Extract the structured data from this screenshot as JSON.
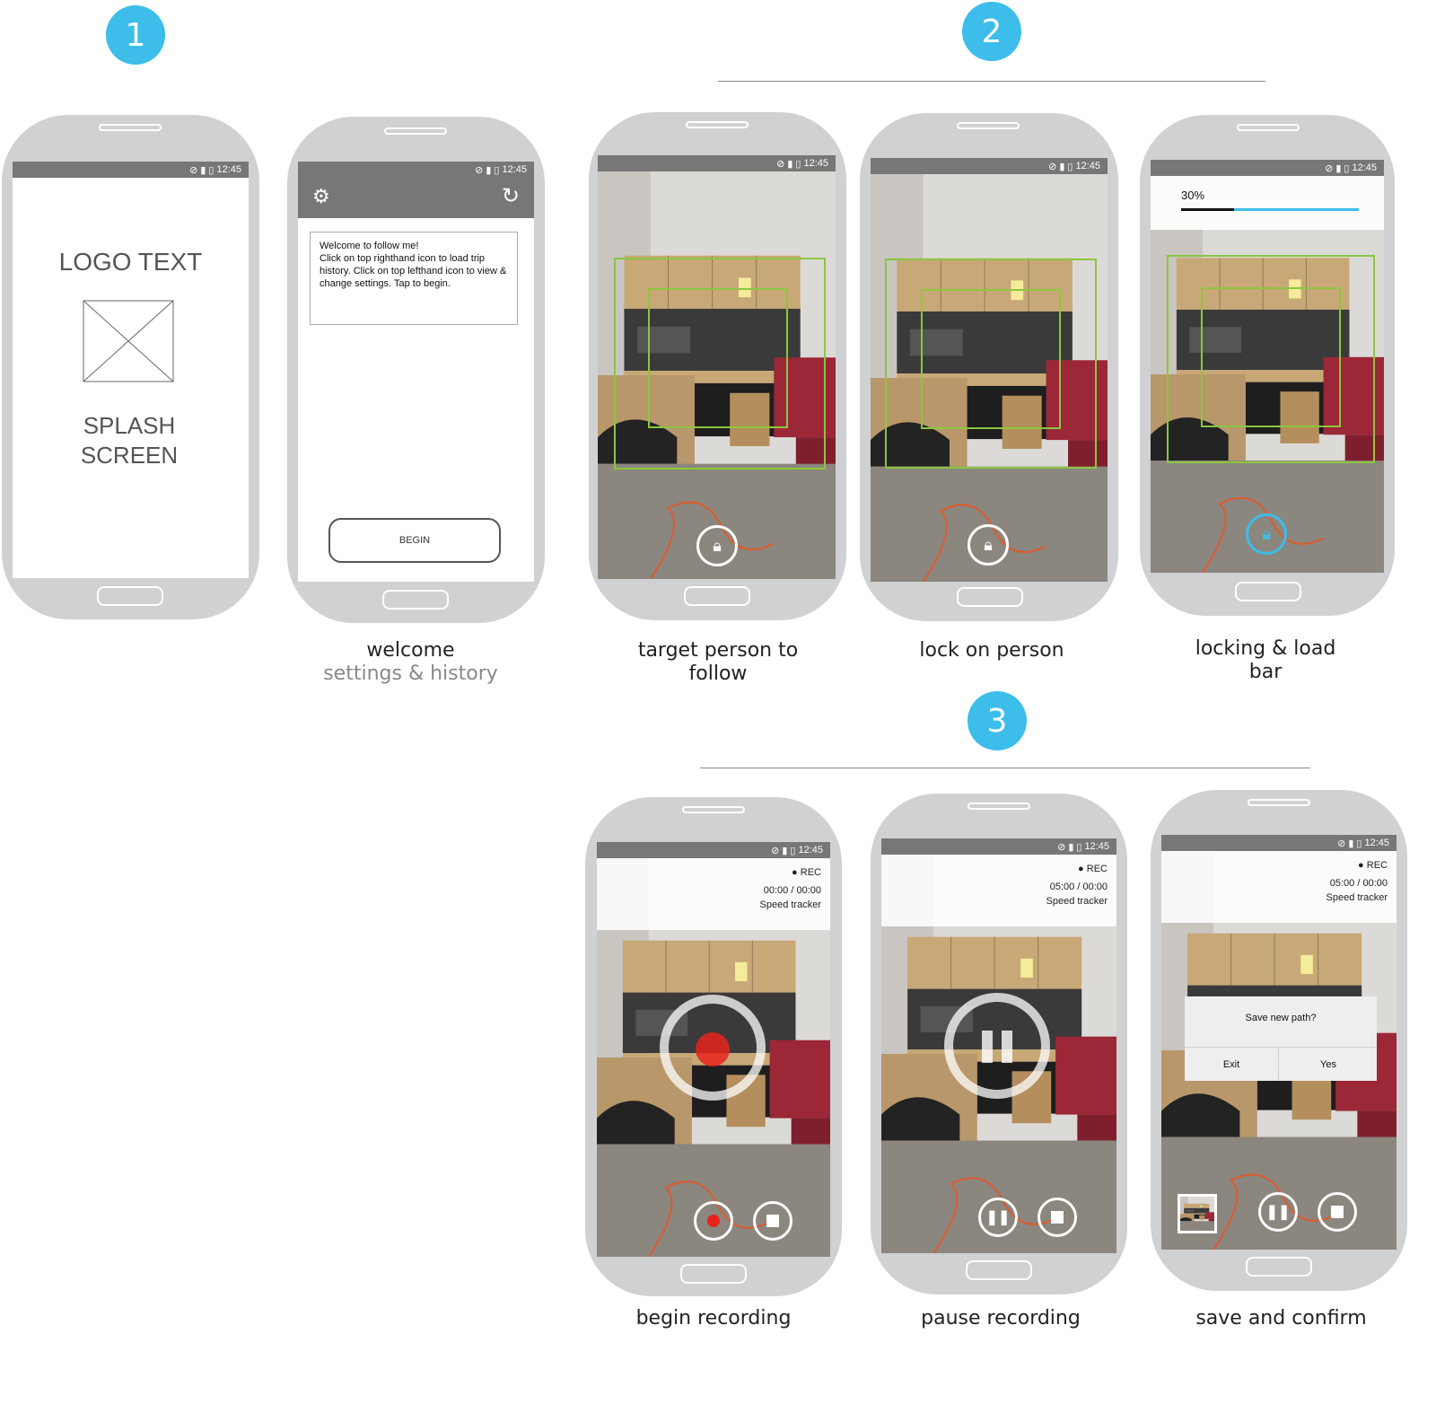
{
  "steps": [
    "1",
    "2",
    "3"
  ],
  "status_time": "12:45",
  "splash": {
    "logo_text": "LOGO TEXT",
    "splash_text": "SPLASH SCREEN"
  },
  "welcome": {
    "message": "Welcome to follow me!\nClick on top righthand icon to load trip history. Click on top lefthand icon to view & change settings. Tap to begin.",
    "begin_label": "BEGIN"
  },
  "locking": {
    "progress_label": "30%",
    "progress": 0.3
  },
  "recording": {
    "rec_label": "REC",
    "speed_label": "Speed tracker",
    "begin_time": "00:00 / 00:00",
    "pause_time": "05:00 / 00:00",
    "save_time": "05:00 / 00:00"
  },
  "dialog": {
    "title": "Save new path?",
    "exit_label": "Exit",
    "yes_label": "Yes"
  },
  "captions": {
    "welcome": "welcome",
    "welcome_sub": "settings & history",
    "target": "target person to follow",
    "lock": "lock on person",
    "locking": "locking & load bar",
    "begin": "begin recording",
    "pause": "pause recording",
    "save": "save and confirm"
  },
  "colors": {
    "accent": "#3dbde9",
    "track_green": "#8cc63f",
    "record_red": "#e8231c",
    "status_gray": "#777777"
  }
}
